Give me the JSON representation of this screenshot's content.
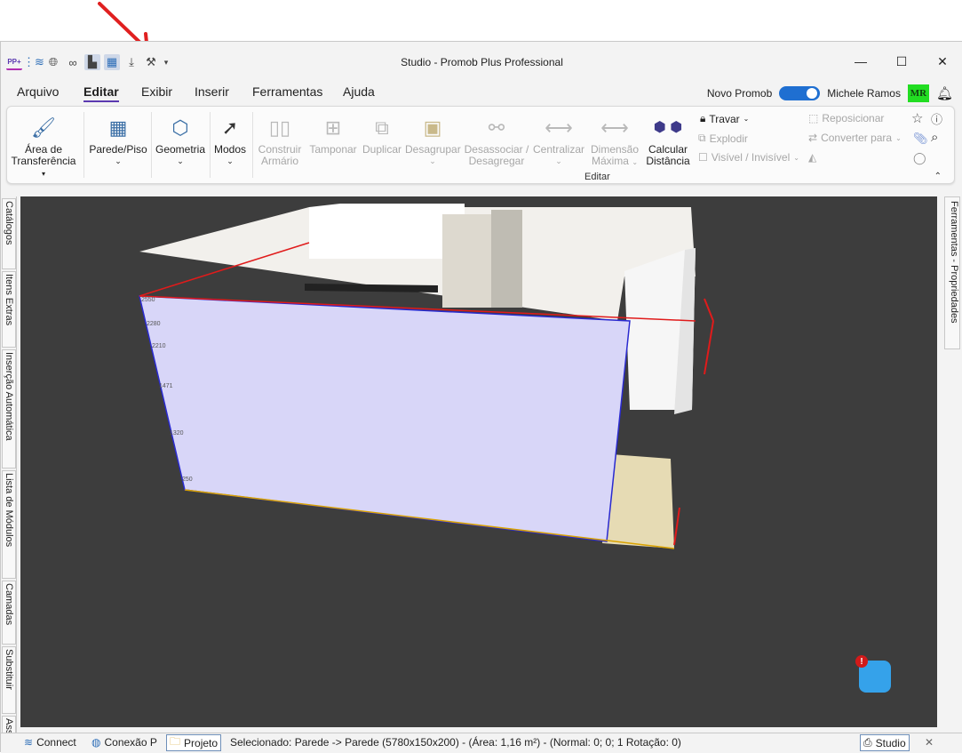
{
  "window": {
    "title": "Studio - Promob Plus Professional"
  },
  "quick_access": {
    "app_badge": "PP+",
    "icons": [
      "rss-icon",
      "globe-icon",
      "glasses-icon",
      "wall-view-icon",
      "grid-view-icon",
      "download-icon",
      "tools-icon"
    ]
  },
  "window_buttons": {
    "minimize": "—",
    "maximize": "☐",
    "close": "✕"
  },
  "menu": {
    "items": [
      "Arquivo",
      "Editar",
      "Exibir",
      "Inserir",
      "Ferramentas",
      "Ajuda"
    ],
    "active": "Editar"
  },
  "account": {
    "toggle_label": "Novo Promob",
    "user_name": "Michele Ramos",
    "initials": "MR"
  },
  "ribbon": {
    "buttons": [
      {
        "label1": "Área de",
        "label2": "Transferência",
        "enabled": true
      },
      {
        "label1": "Parede/Piso",
        "label2": "",
        "enabled": true
      },
      {
        "label1": "Geometria",
        "label2": "",
        "enabled": true
      },
      {
        "label1": "Modos",
        "label2": "",
        "enabled": true
      },
      {
        "label1": "Construir",
        "label2": "Armário",
        "enabled": false
      },
      {
        "label1": "Tamponar",
        "label2": "",
        "enabled": false
      },
      {
        "label1": "Duplicar",
        "label2": "",
        "enabled": false
      },
      {
        "label1": "Desagrupar",
        "label2": "",
        "enabled": false
      },
      {
        "label1": "Desassociar /",
        "label2": "Desagregar",
        "enabled": false
      },
      {
        "label1": "Centralizar",
        "label2": "",
        "enabled": false
      },
      {
        "label1": "Dimensão",
        "label2": "Máxima",
        "enabled": false
      },
      {
        "label1": "Calcular",
        "label2": "Distância",
        "enabled": true
      }
    ],
    "small": {
      "travar": "Travar",
      "explodir": "Explodir",
      "visivel": "Visível / Invisível",
      "reposicionar": "Reposicionar",
      "converter": "Converter para"
    },
    "group_caption": "Editar"
  },
  "left_tabs": [
    "Catálogos",
    "Itens Extras",
    "Inserção Automática",
    "Lista de Módulos",
    "Camadas",
    "Substituir",
    "Ass"
  ],
  "right_tabs": [
    "Ferramentas - Propriedades"
  ],
  "dimension_marks": [
    "2550",
    "2280",
    "2210",
    "1471",
    "1320",
    "250"
  ],
  "statusbar": {
    "connect": "Connect",
    "conexao": "Conexão P",
    "projeto": "Projeto",
    "message": "Selecionado: Parede -> Parede (5780x150x200) - (Área: 1,16 m²) - (Normal: 0; 0; 1 Rotação: 0)",
    "studio": "Studio"
  },
  "colors": {
    "accent": "#5b3ab0",
    "toggle": "#1f6fd1",
    "viewport_bg": "#3d3d3d",
    "selected_wall": "#d8d6f8",
    "annotation_arrow": "#e02020"
  }
}
